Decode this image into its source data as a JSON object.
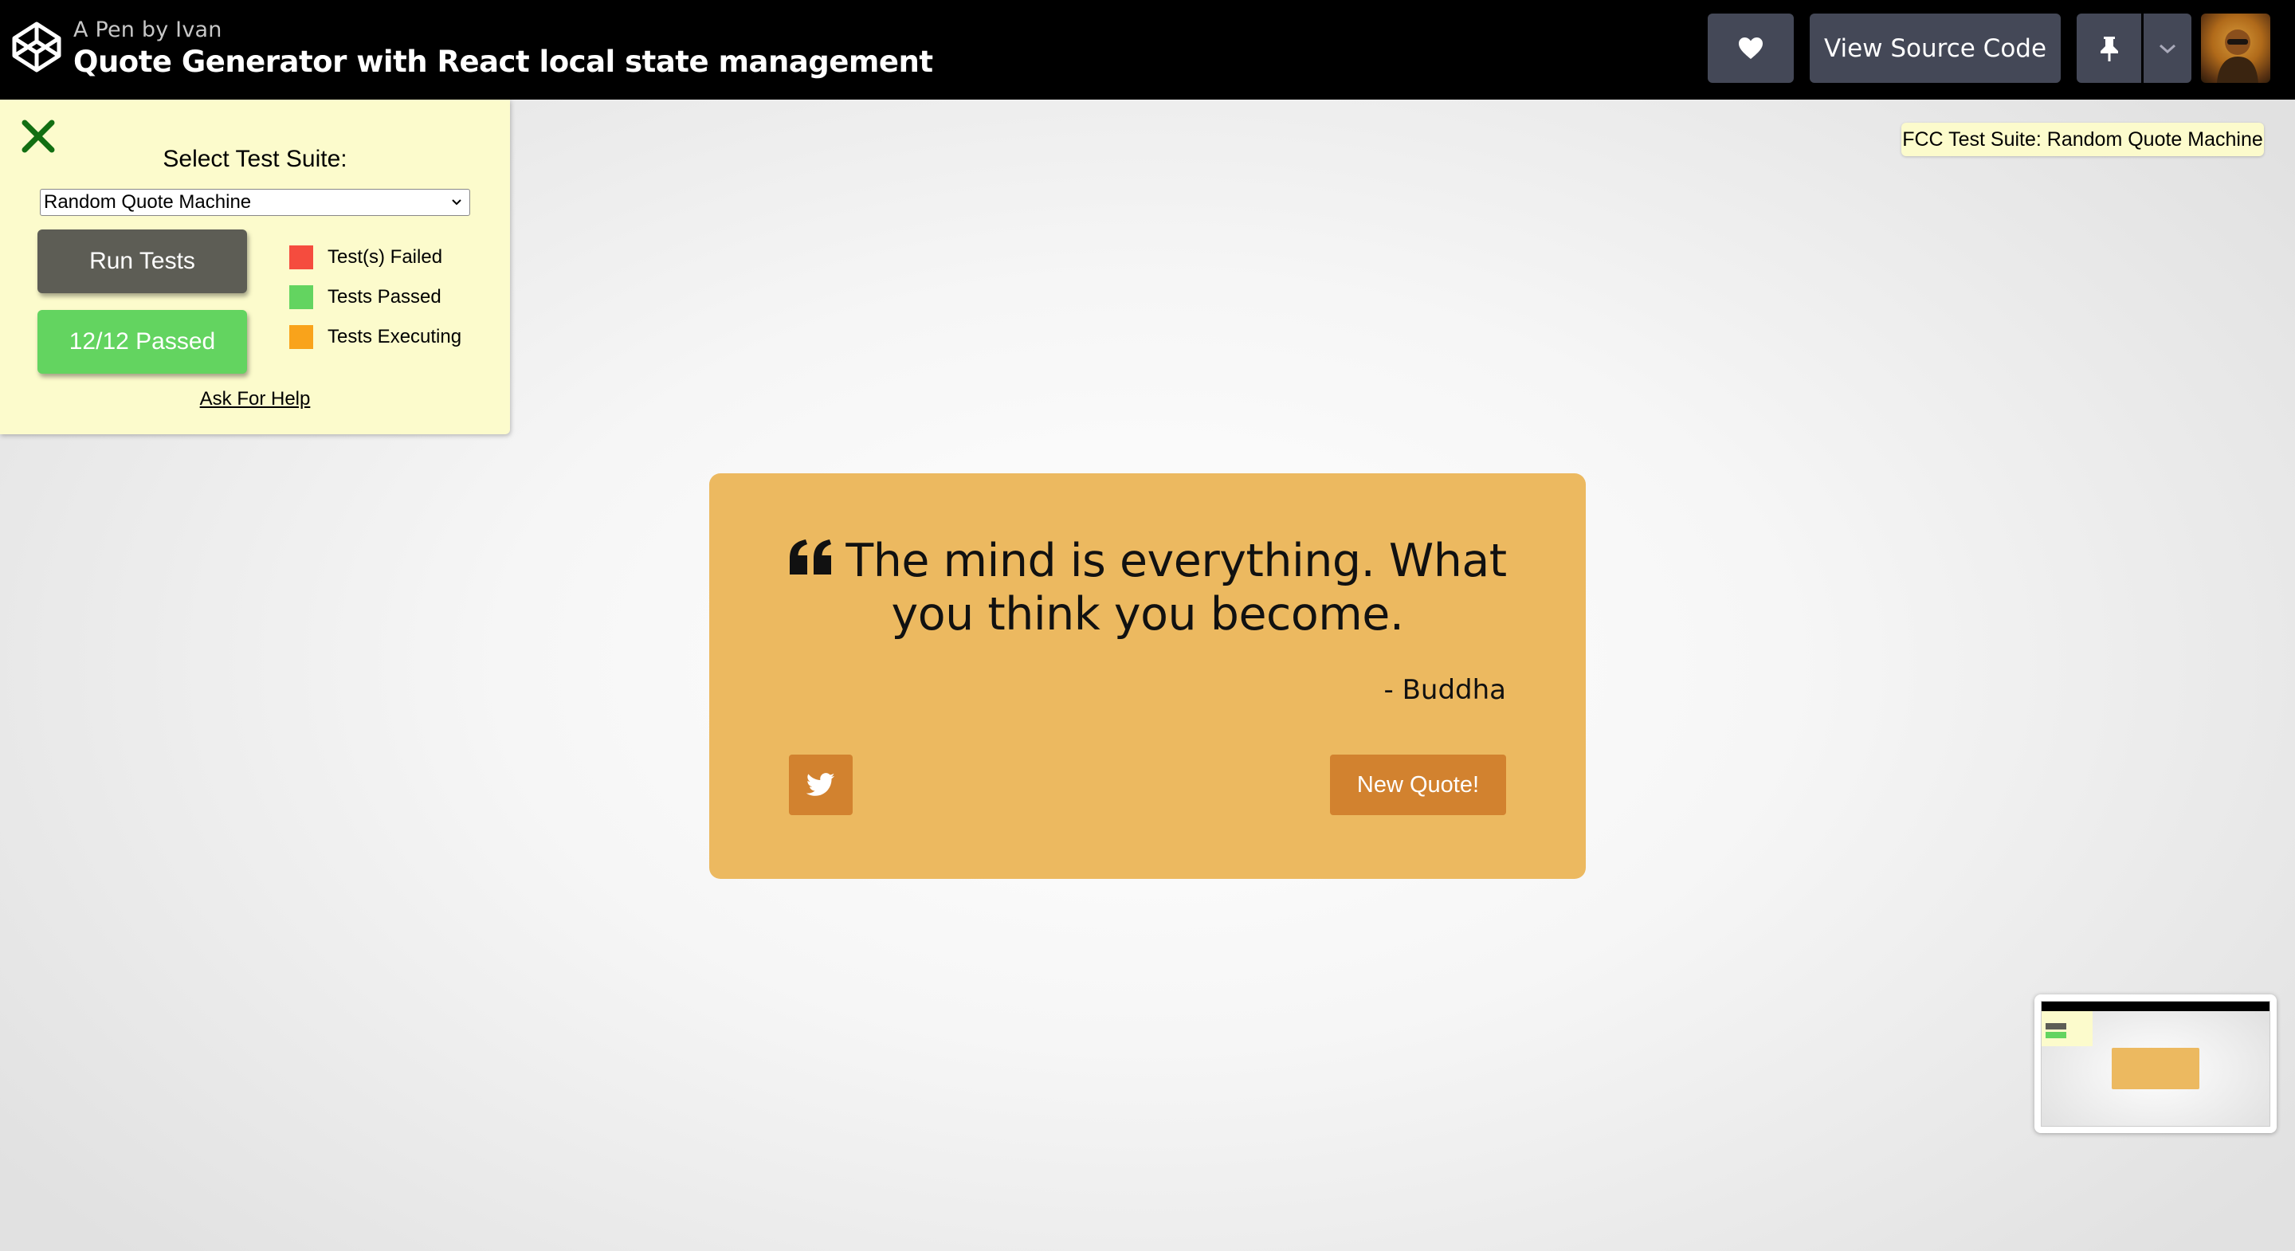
{
  "topbar": {
    "pen_by": "A Pen by Ivan",
    "title": "Quote Generator with React local state management",
    "heart_icon": "heart-icon",
    "view_source_label": "View Source Code",
    "pin_icon": "pin-icon",
    "menu_icon": "chevron-down-icon",
    "avatar_icon": "user-avatar"
  },
  "test_panel": {
    "close_icon": "close-icon",
    "select_label": "Select Test Suite:",
    "selected_suite": "Random Quote Machine",
    "run_button": "Run Tests",
    "passed_button": "12/12 Passed",
    "legend": [
      {
        "label": "Test(s) Failed",
        "color": "#f54c3e"
      },
      {
        "label": "Tests Passed",
        "color": "#63d460"
      },
      {
        "label": "Tests Executing",
        "color": "#f9a31b"
      }
    ],
    "help_link": "Ask For Help"
  },
  "fcc_badge": "FCC Test Suite: Random Quote Machine",
  "quote_card": {
    "quote_icon": "quote-left-icon",
    "text": "The mind is everything. What you think you become.",
    "author": "- Buddha",
    "tweet_icon": "twitter-icon",
    "new_quote_button": "New Quote!"
  },
  "colors": {
    "card": "#ecb960",
    "card_button": "#d2822f",
    "panel": "#fcfbcc",
    "topbar": "#000000",
    "topbar_button": "#444857"
  }
}
